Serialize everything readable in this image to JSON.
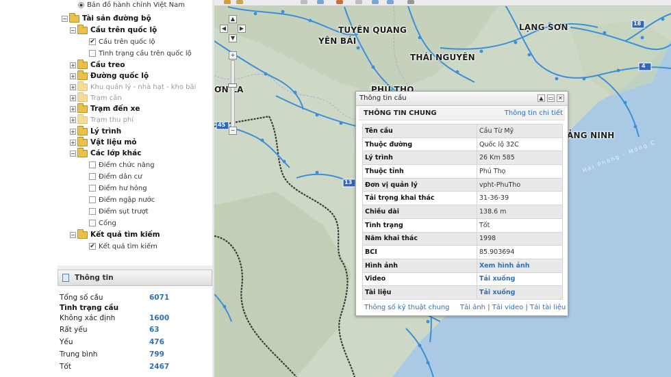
{
  "tree": {
    "base_layer": "Bản đồ hành chính Việt Nam",
    "road_assets": "Tài sản đường bộ",
    "bridge_on_highway": "Cầu trên quốc lộ",
    "bridge_on_highway_child": "Cầu trên quốc lộ",
    "bridge_condition": "Tình trạng cầu trên quốc lộ",
    "suspension_bridge": "Cầu treo",
    "national_road": "Đường quốc lộ",
    "management_area": "Khu quản lý - nhà hạt - kho bãi",
    "weigh_station": "Trạm cân",
    "ferry_station": "Trạm đến xe",
    "toll_station": "Trạm thu phí",
    "mileage": "Lý trình",
    "material_pit": "Vật liệu mỏ",
    "other_layers": "Các lớp khác",
    "other_items": [
      "Điểm chức năng",
      "Điểm dân cư",
      "Điểm hư hỏng",
      "Điểm ngập nước",
      "Điểm sụt trượt",
      "Cống"
    ],
    "search_results": "Kết quả tìm kiếm",
    "search_results_child": "Kết quả tìm kiếm"
  },
  "info_panel": {
    "title": "Thông tin",
    "total_label": "Tổng số cầu",
    "total_value": "6071",
    "condition_title": "Tình trạng cầu",
    "rows": [
      {
        "label": "Không xác định",
        "value": "1600"
      },
      {
        "label": "Rất yếu",
        "value": "63"
      },
      {
        "label": "Yếu",
        "value": "476"
      },
      {
        "label": "Trung bình",
        "value": "799"
      },
      {
        "label": "Tốt",
        "value": "2467"
      }
    ]
  },
  "map": {
    "labels": {
      "tuyen_quang": "TUYÊN QUANG",
      "yen_bai": "YÊN BÁI",
      "thai_nguyen": "THÁI NGUYÊN",
      "lang_son": "LẠNG SƠN",
      "phu_tho": "PHÚ THỌ",
      "son_la": "ƠN LA",
      "quang_ninh": "ẢNG NINH"
    },
    "sea_label": "Hải Phòng - Móng C",
    "road_shields": [
      "4",
      "45",
      "13",
      "18"
    ]
  },
  "popup": {
    "title": "Thông tin cầu",
    "section": "THÔNG TIN CHUNG",
    "detail_link": "Thông tin chi tiết",
    "rows": [
      {
        "key": "Tên cầu",
        "value": "Cầu Từ Mỹ"
      },
      {
        "key": "Thuộc đường",
        "value": "Quốc lộ 32C"
      },
      {
        "key": "Lý trình",
        "value": "26 Km 585"
      },
      {
        "key": "Thuộc tỉnh",
        "value": "Phú Thọ"
      },
      {
        "key": "Đơn vị quản lý",
        "value": "vpht-PhuTho"
      },
      {
        "key": "Tải trọng khai thác",
        "value": "31-36-39"
      },
      {
        "key": "Chiều dài",
        "value": "138.6 m"
      },
      {
        "key": "Tình trạng",
        "value": "Tốt"
      },
      {
        "key": "Năm khai thác",
        "value": "1998"
      },
      {
        "key": "BCI",
        "value": "85.903694"
      },
      {
        "key": "Hình ảnh",
        "value": "Xem hình ảnh"
      },
      {
        "key": "Video",
        "value": "Tải xuống"
      },
      {
        "key": "Tài liệu",
        "value": "Tải xuống"
      }
    ],
    "footer_specs": "Thông số kỹ thuật chung",
    "footer_image": "Tải ảnh",
    "footer_video": "Tải video",
    "footer_doc": "Tải tài liệu",
    "footer_sep": "|"
  },
  "colors": {
    "link": "#2e70b8",
    "folder": "#e8c14a",
    "road": "#3a8fd8",
    "border_line": "#333333"
  }
}
